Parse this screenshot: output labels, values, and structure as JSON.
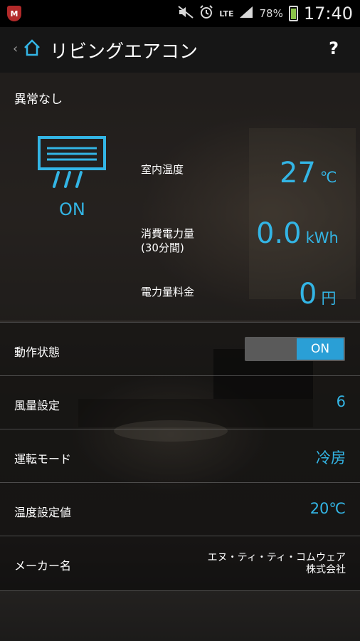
{
  "status_bar": {
    "battery_percent": "78%",
    "network": "LTE",
    "time": "17:40",
    "icons": [
      "mcafee-icon",
      "mute-icon",
      "alarm-icon",
      "lte-icon",
      "signal-icon",
      "battery-icon"
    ]
  },
  "action_bar": {
    "title": "リビングエアコン",
    "help_label": "?"
  },
  "device": {
    "status": "異常なし",
    "power_state": "ON",
    "icon": "air-conditioner-icon"
  },
  "metrics": [
    {
      "label": "室内温度",
      "value": "27",
      "unit": "℃"
    },
    {
      "label": "消費電力量\n(30分間)",
      "value": "0.0",
      "unit": "kWh"
    },
    {
      "label": "電力量料金",
      "value": "0",
      "unit": "円"
    }
  ],
  "settings": {
    "operation": {
      "label": "動作状態",
      "toggle_value": "ON"
    },
    "fan": {
      "label": "風量設定",
      "value": "6"
    },
    "mode": {
      "label": "運転モード",
      "value": "冷房"
    },
    "temp": {
      "label": "温度設定値",
      "value": "20℃"
    },
    "maker": {
      "label": "メーカー名",
      "value": "エヌ・ティ・ティ・コムウェア\n株式会社"
    }
  },
  "colors": {
    "accent": "#33b5e5",
    "toggle_on": "#2a9fd6"
  }
}
